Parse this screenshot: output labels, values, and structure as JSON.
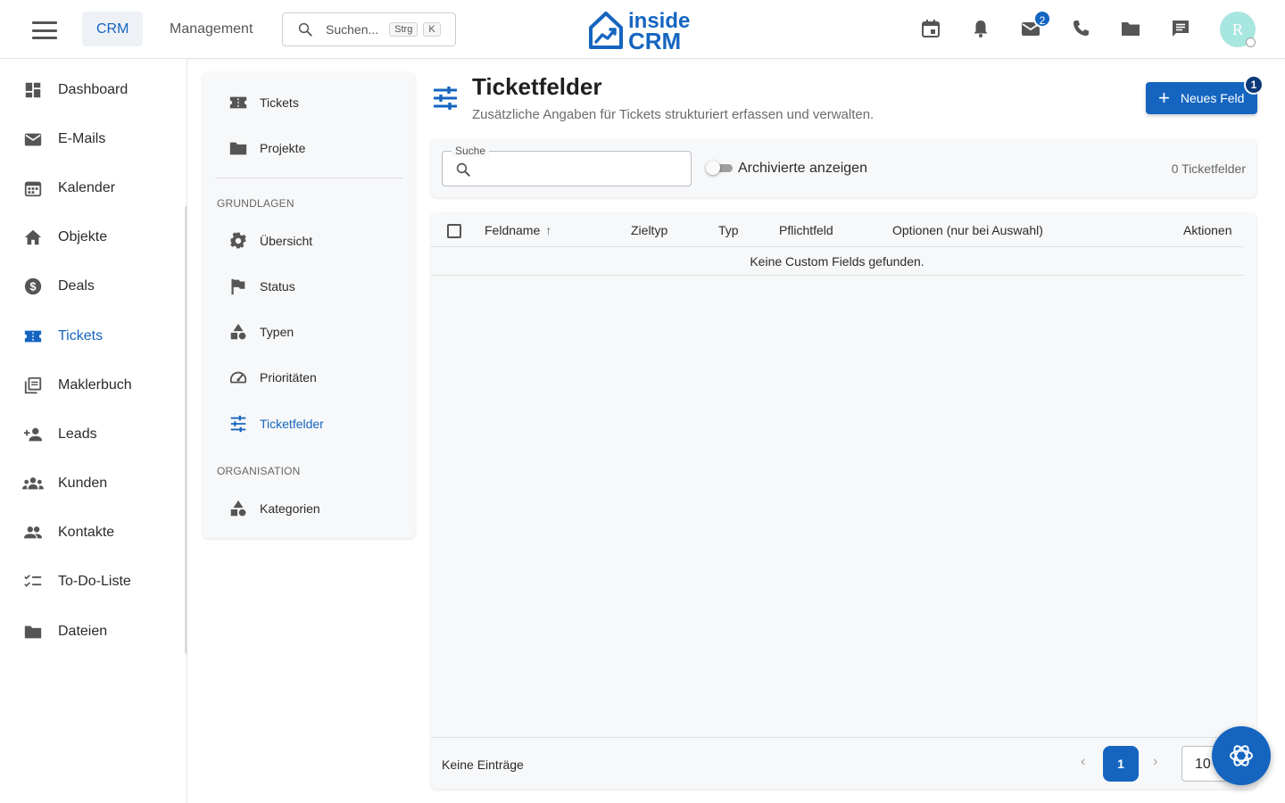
{
  "header": {
    "tabs": [
      {
        "label": "CRM"
      },
      {
        "label": "Management"
      }
    ],
    "search": {
      "placeholder": "Suchen...",
      "kbd1": "Strg",
      "kbd2": "K"
    },
    "logo": {
      "line1": "inside",
      "line2": "CRM"
    },
    "icons": [
      "calendar-icon",
      "bell-icon",
      "mail-icon",
      "phone-icon",
      "folder-icon",
      "chat-icon"
    ],
    "mail_badge": "2",
    "avatar_initial": "R"
  },
  "sidebar": {
    "items": [
      {
        "label": "Dashboard",
        "icon": "dashboard-icon"
      },
      {
        "label": "E-Mails",
        "icon": "mail-icon"
      },
      {
        "label": "Kalender",
        "icon": "calendar-icon"
      },
      {
        "label": "Objekte",
        "icon": "home-icon"
      },
      {
        "label": "Deals",
        "icon": "dollar-icon"
      },
      {
        "label": "Tickets",
        "icon": "ticket-icon",
        "active": true
      },
      {
        "label": "Maklerbuch",
        "icon": "book-icon"
      },
      {
        "label": "Leads",
        "icon": "person-add-icon"
      },
      {
        "label": "Kunden",
        "icon": "groups-icon"
      },
      {
        "label": "Kontakte",
        "icon": "people-icon"
      },
      {
        "label": "To-Do-Liste",
        "icon": "checklist-icon"
      },
      {
        "label": "Dateien",
        "icon": "folder-icon"
      }
    ]
  },
  "subnav": {
    "top_items": [
      {
        "label": "Tickets",
        "icon": "ticket-icon"
      },
      {
        "label": "Projekte",
        "icon": "folder-icon"
      }
    ],
    "section1": {
      "heading": "GRUNDLAGEN",
      "items": [
        {
          "label": "Übersicht",
          "icon": "gear-icon"
        },
        {
          "label": "Status",
          "icon": "flag-icon"
        },
        {
          "label": "Typen",
          "icon": "shapes-icon"
        },
        {
          "label": "Prioritäten",
          "icon": "speedometer-icon"
        },
        {
          "label": "Ticketfelder",
          "icon": "tune-icon",
          "active": true
        }
      ]
    },
    "section2": {
      "heading": "ORGANISATION",
      "items": [
        {
          "label": "Kategorien",
          "icon": "shapes-icon"
        }
      ]
    }
  },
  "main": {
    "title": "Ticketfelder",
    "subtitle": "Zusätzliche Angaben für Tickets strukturiert erfassen und verwalten.",
    "new_button": "Neues Feld",
    "new_badge": "1",
    "filter": {
      "search_label": "Suche",
      "search_value": "",
      "toggle_label": "Archivierte anzeigen",
      "toggle_on": false,
      "count": "0 Ticketfelder"
    },
    "table": {
      "columns": [
        "Feldname",
        "Zieltyp",
        "Typ",
        "Pflichtfeld",
        "Optionen (nur bei Auswahl)",
        "Aktionen"
      ],
      "sort_column": "Feldname",
      "sort_dir": "asc",
      "empty_message": "Keine Custom Fields gefunden.",
      "footer": {
        "entries_text": "Keine Einträge",
        "prev": "‹",
        "next": "›",
        "current_page": "1",
        "per_page": "10"
      }
    }
  },
  "colors": {
    "accent": "#1565c0",
    "badge_dark": "#0d3a78",
    "avatar_bg": "#a8e6e0",
    "card_bg": "#f7f8f9"
  }
}
